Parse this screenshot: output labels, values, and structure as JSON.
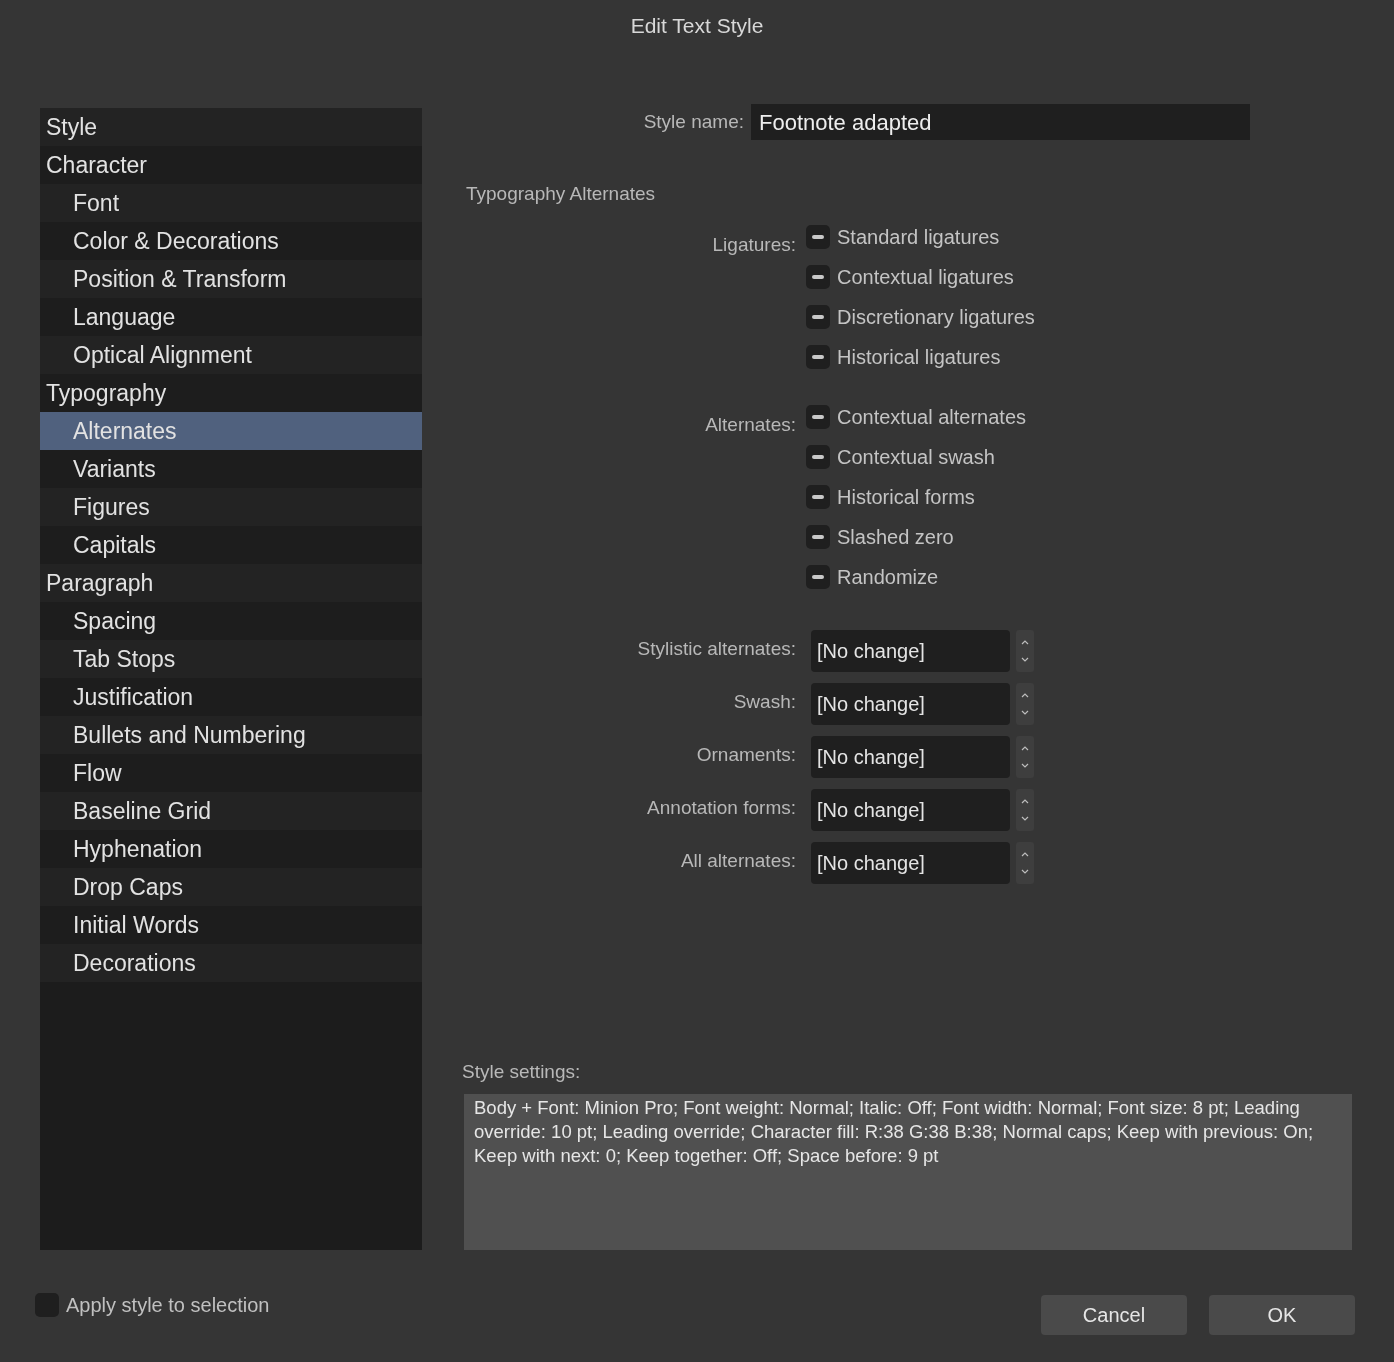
{
  "window": {
    "title": "Edit Text Style"
  },
  "sidebar": {
    "items": [
      {
        "label": "Style",
        "selected": false
      },
      {
        "label": "Character",
        "selected": false,
        "children": [
          {
            "label": "Font",
            "selected": false
          },
          {
            "label": "Color & Decorations",
            "selected": false
          },
          {
            "label": "Position & Transform",
            "selected": false
          },
          {
            "label": "Language",
            "selected": false
          },
          {
            "label": "Optical Alignment",
            "selected": false
          }
        ]
      },
      {
        "label": "Typography",
        "selected": false,
        "children": [
          {
            "label": "Alternates",
            "selected": true
          },
          {
            "label": "Variants",
            "selected": false
          },
          {
            "label": "Figures",
            "selected": false
          },
          {
            "label": "Capitals",
            "selected": false
          }
        ]
      },
      {
        "label": "Paragraph",
        "selected": false,
        "children": [
          {
            "label": "Spacing",
            "selected": false
          },
          {
            "label": "Tab Stops",
            "selected": false
          },
          {
            "label": "Justification",
            "selected": false
          },
          {
            "label": "Bullets and Numbering",
            "selected": false
          },
          {
            "label": "Flow",
            "selected": false
          },
          {
            "label": "Baseline Grid",
            "selected": false
          },
          {
            "label": "Hyphenation",
            "selected": false
          },
          {
            "label": "Drop Caps",
            "selected": false
          },
          {
            "label": "Initial Words",
            "selected": false
          },
          {
            "label": "Decorations",
            "selected": false
          }
        ]
      }
    ]
  },
  "style_name": {
    "label": "Style name:",
    "value": "Footnote adapted"
  },
  "section_title": "Typography Alternates",
  "checkbox_groups": [
    {
      "label": "Ligatures:",
      "options": [
        {
          "label": "Standard ligatures",
          "indeterminate": true
        },
        {
          "label": "Contextual ligatures",
          "indeterminate": true
        },
        {
          "label": "Discretionary ligatures",
          "indeterminate": true
        },
        {
          "label": "Historical ligatures",
          "indeterminate": true
        }
      ]
    },
    {
      "label": "Alternates:",
      "options": [
        {
          "label": "Contextual alternates",
          "indeterminate": true
        },
        {
          "label": "Contextual swash",
          "indeterminate": true
        },
        {
          "label": "Historical forms",
          "indeterminate": true
        },
        {
          "label": "Slashed zero",
          "indeterminate": true
        },
        {
          "label": "Randomize",
          "indeterminate": true
        }
      ]
    }
  ],
  "selects": [
    {
      "label": "Stylistic alternates:",
      "value": "[No change]"
    },
    {
      "label": "Swash:",
      "value": "[No change]"
    },
    {
      "label": "Ornaments:",
      "value": "[No change]"
    },
    {
      "label": "Annotation forms:",
      "value": "[No change]"
    },
    {
      "label": "All alternates:",
      "value": "[No change]"
    }
  ],
  "style_settings": {
    "label": "Style settings:",
    "text": "Body + Font: Minion Pro; Font weight: Normal; Italic: Off; Font width: Normal; Font size: 8 pt; Leading override: 10 pt; Leading override; Character fill: R:38 G:38 B:38; Normal caps; Keep with previous: On; Keep with next: 0; Keep together: Off; Space before: 9 pt"
  },
  "apply_checkbox": {
    "label": "Apply style to selection",
    "checked": false
  },
  "buttons": [
    "Cancel",
    "OK"
  ]
}
